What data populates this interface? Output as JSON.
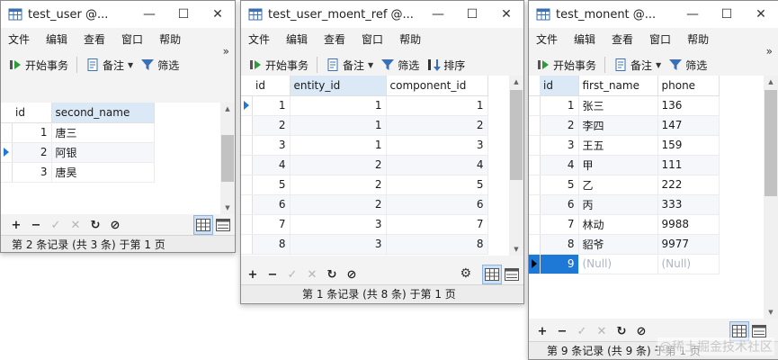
{
  "windows": {
    "user": {
      "title": "test_user @...",
      "menu": [
        "文件",
        "编辑",
        "查看",
        "窗口",
        "帮助"
      ],
      "toolbar": {
        "begin": "开始事务",
        "memo": "备注",
        "filter": "筛选"
      },
      "chevron": "»",
      "columns": [
        "id",
        "second_name"
      ],
      "rows": [
        [
          "1",
          "唐三"
        ],
        [
          "2",
          "阿银"
        ],
        [
          "3",
          "唐昊"
        ]
      ],
      "status": "第 2 条记录 (共 3 条) 于第 1 页"
    },
    "ref": {
      "title": "test_user_moent_ref @...",
      "menu": [
        "文件",
        "编辑",
        "查看",
        "窗口",
        "帮助"
      ],
      "toolbar": {
        "begin": "开始事务",
        "memo": "备注",
        "filter": "筛选",
        "sort": "排序"
      },
      "columns": [
        "id",
        "entity_id",
        "component_id"
      ],
      "rows": [
        [
          "1",
          "1",
          "1"
        ],
        [
          "2",
          "1",
          "2"
        ],
        [
          "3",
          "1",
          "3"
        ],
        [
          "4",
          "2",
          "4"
        ],
        [
          "5",
          "2",
          "5"
        ],
        [
          "6",
          "2",
          "6"
        ],
        [
          "7",
          "3",
          "7"
        ],
        [
          "8",
          "3",
          "8"
        ]
      ],
      "status": "第 1 条记录 (共 8 条) 于第 1 页"
    },
    "monent": {
      "title": "test_monent @...",
      "menu": [
        "文件",
        "编辑",
        "查看",
        "窗口",
        "帮助"
      ],
      "toolbar": {
        "begin": "开始事务",
        "memo": "备注",
        "filter": "筛选"
      },
      "chevron": "»",
      "columns": [
        "id",
        "first_name",
        "phone"
      ],
      "rows": [
        [
          "1",
          "张三",
          "136"
        ],
        [
          "2",
          "李四",
          "147"
        ],
        [
          "3",
          "王五",
          "159"
        ],
        [
          "4",
          "甲",
          "111"
        ],
        [
          "5",
          "乙",
          "222"
        ],
        [
          "6",
          "丙",
          "333"
        ],
        [
          "7",
          "林动",
          "9988"
        ],
        [
          "8",
          "貂爷",
          "9977"
        ],
        [
          "9",
          "(Null)",
          "(Null)"
        ]
      ],
      "status": "第 9 条记录 (共 9 条) 于第 1 页"
    }
  },
  "controls": {
    "minimize": "—",
    "maximize": "☐",
    "close": "✕",
    "add": "+",
    "remove": "−",
    "apply": "✓",
    "discard": "✕",
    "refresh": "↻",
    "stop": "⊘"
  },
  "watermark": "@稀土掘金技术社区",
  "colors": {
    "accent": "#1e78d6",
    "selected_header": "#dbe8f6",
    "null_text": "#aab4c4"
  },
  "icons": [
    "table-icon",
    "begin-transaction-icon",
    "memo-icon",
    "filter-icon",
    "sort-icon",
    "gear-icon",
    "grid-view-icon",
    "form-view-icon"
  ]
}
